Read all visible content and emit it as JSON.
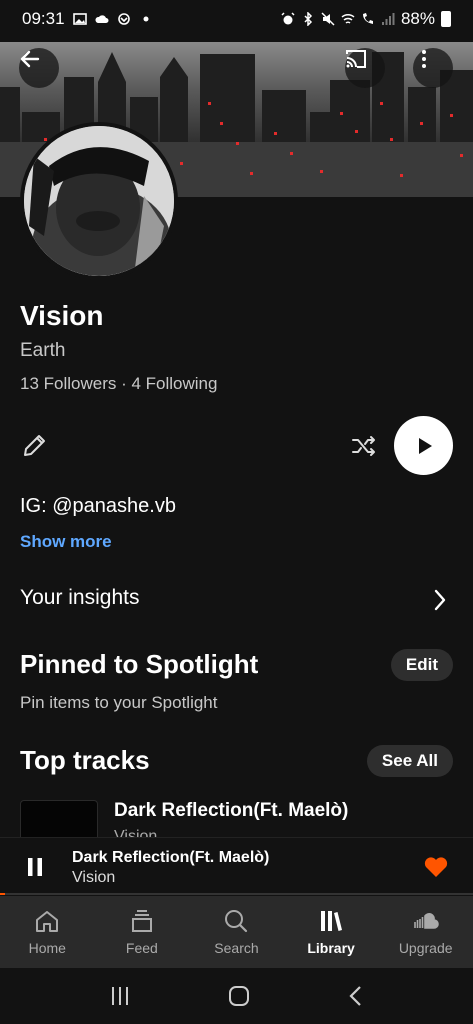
{
  "status_bar": {
    "time": "09:31",
    "battery": "88%"
  },
  "header": {
    "back_icon": "arrow-left-icon",
    "cast_icon": "cast-icon",
    "more_icon": "more-vertical-icon"
  },
  "profile": {
    "name": "Vision",
    "location": "Earth",
    "stats": "13 Followers · 4 Following",
    "bio": "IG: @panashe.vb",
    "show_more": "Show more"
  },
  "actions": {
    "edit_icon": "pencil-icon",
    "shuffle_icon": "shuffle-icon",
    "play_icon": "play-icon"
  },
  "insights": {
    "label": "Your insights"
  },
  "spotlight": {
    "title": "Pinned to Spotlight",
    "edit_label": "Edit",
    "subtitle": "Pin items to your Spotlight"
  },
  "top_tracks": {
    "title": "Top tracks",
    "see_all_label": "See All",
    "items": [
      {
        "title": "Dark Reflection(Ft. Maelò)",
        "artist": "Vision"
      }
    ]
  },
  "mini_player": {
    "title": "Dark Reflection(Ft. Maelò)",
    "artist": "Vision",
    "progress": 0.01,
    "accent": "#ff5500"
  },
  "nav": {
    "items": [
      {
        "label": "Home",
        "icon": "home-icon"
      },
      {
        "label": "Feed",
        "icon": "feed-icon"
      },
      {
        "label": "Search",
        "icon": "search-icon"
      },
      {
        "label": "Library",
        "icon": "library-icon",
        "active": true
      },
      {
        "label": "Upgrade",
        "icon": "cloud-icon"
      }
    ]
  },
  "colors": {
    "background": "#121212",
    "link": "#5fa8ff",
    "accent": "#ff5500",
    "nav_bg": "#2a2a2a"
  }
}
